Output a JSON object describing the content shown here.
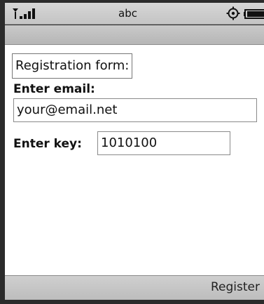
{
  "status_bar": {
    "input_mode": "abc",
    "icons": [
      "signal-strength-icon",
      "settings-gear-icon",
      "battery-icon"
    ]
  },
  "form": {
    "title": "Registration form:",
    "email_label": "Enter email:",
    "email_value": "your@email.net",
    "key_label": "Enter key:",
    "key_value": "1010100"
  },
  "softkeys": {
    "right_label": "Register"
  },
  "colors": {
    "bar_gray": "#c4c4c4",
    "frame_dark": "#2b2b2b",
    "content_bg": "#ffffff"
  }
}
